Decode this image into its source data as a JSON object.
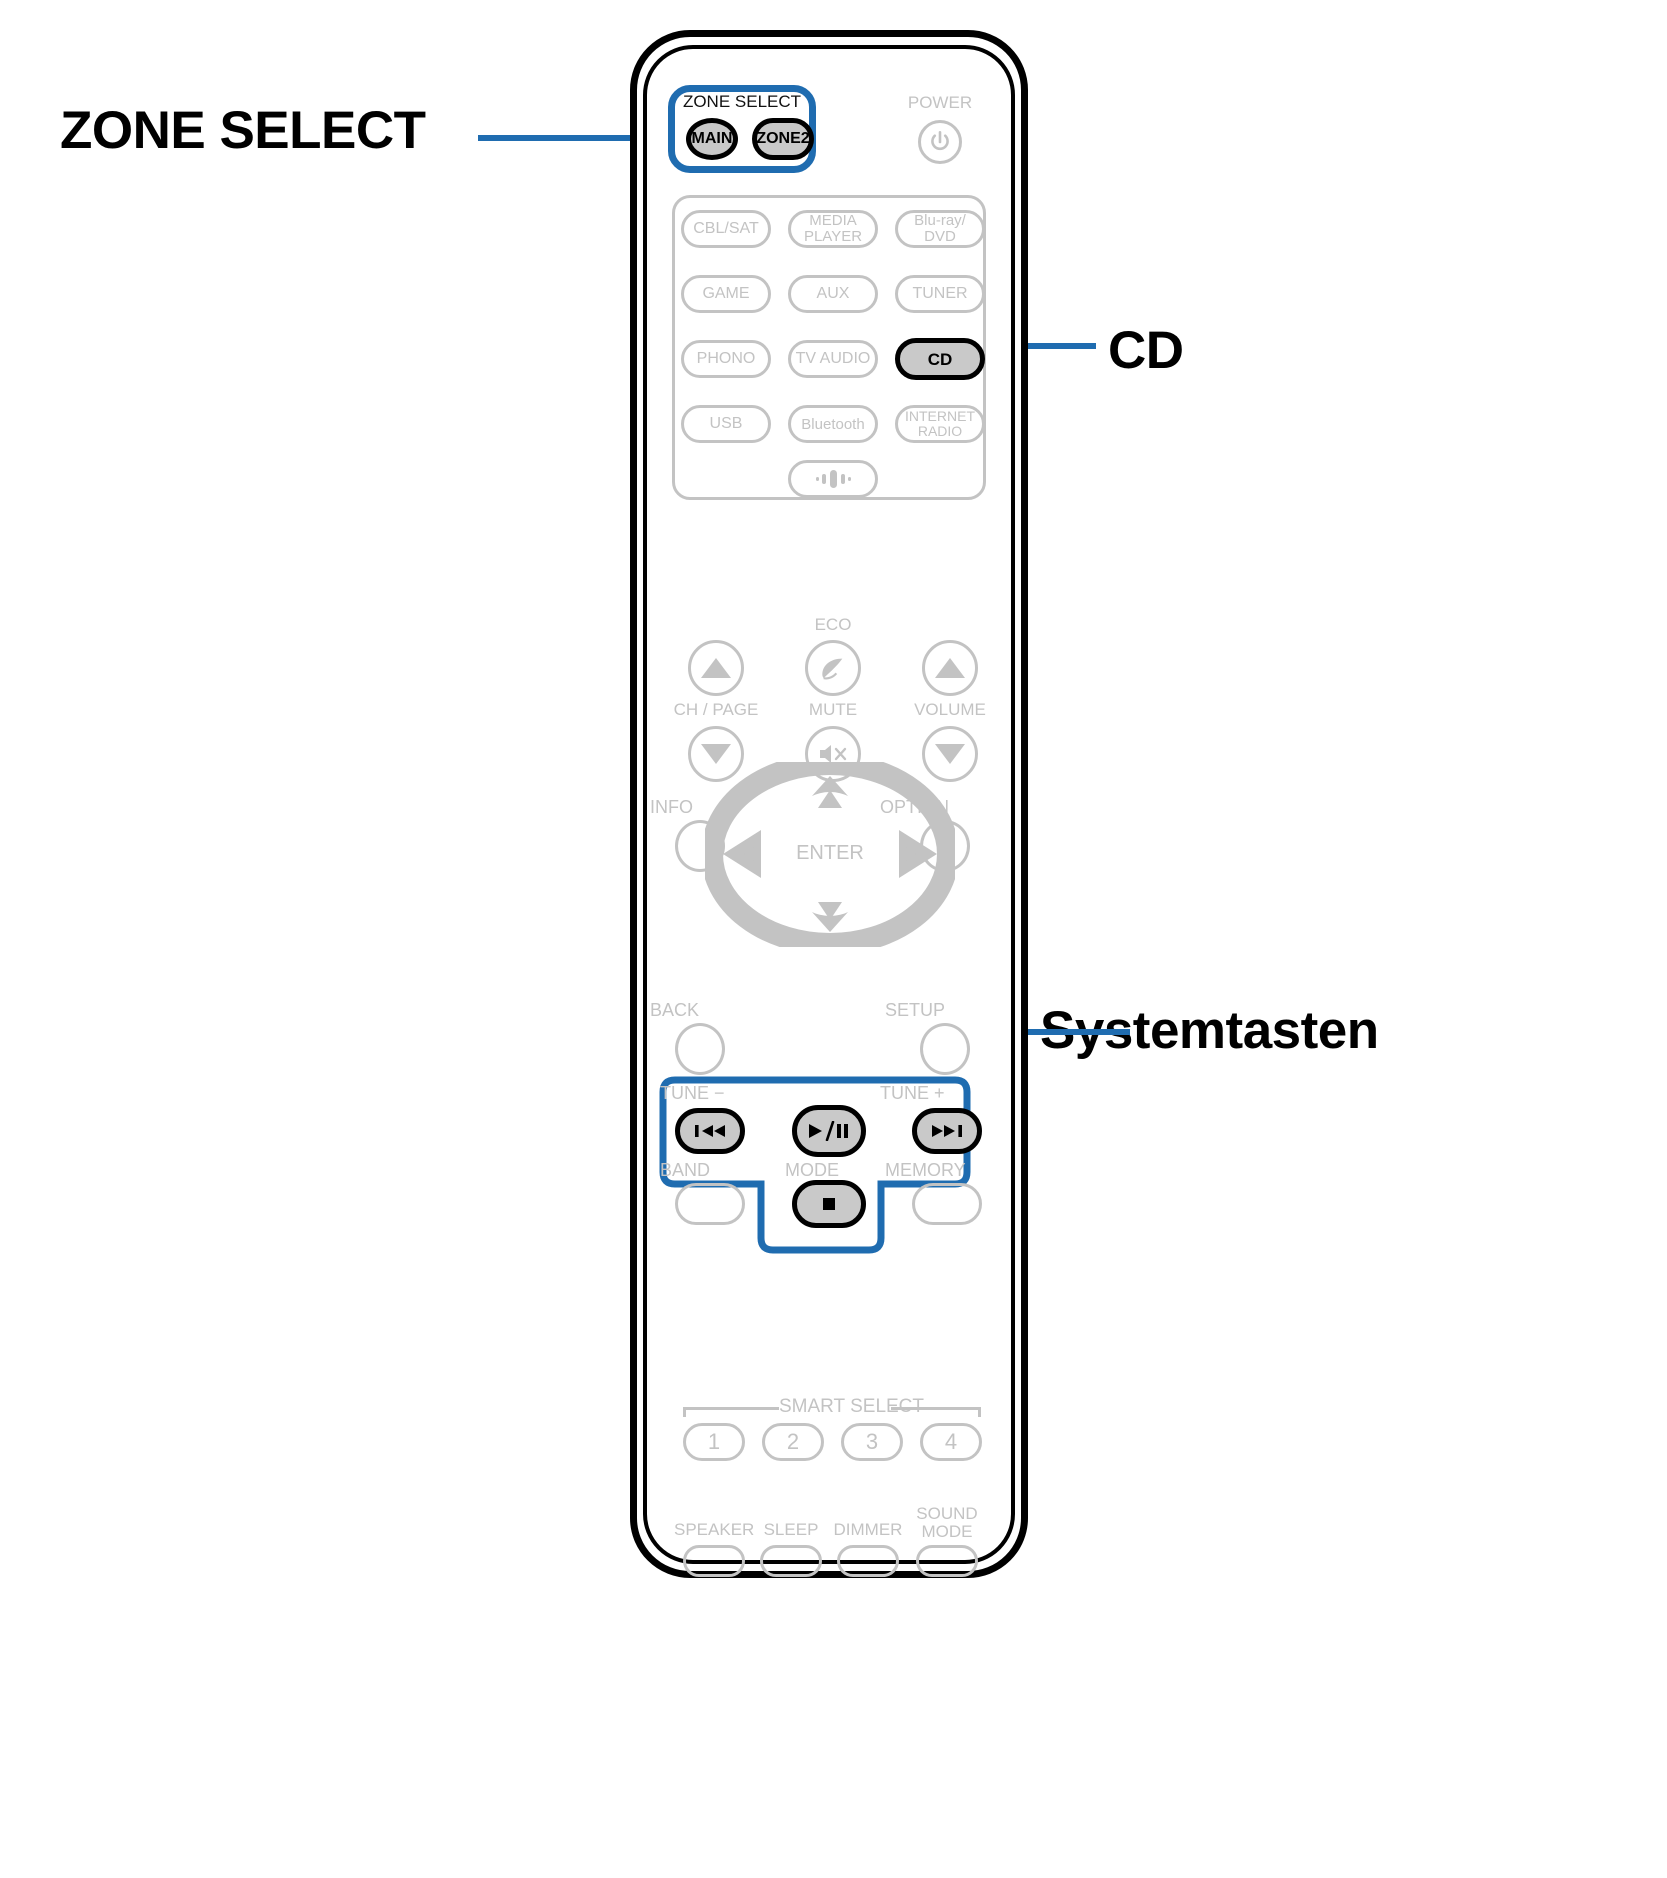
{
  "document": {
    "type": "remote-control-diagram",
    "device": "AV receiver remote control",
    "accent_color": "#1f6cb0",
    "faded_color": "#c3c3c3",
    "highlight_fill": "#c9c9c9"
  },
  "callouts": [
    {
      "id": "zone-select",
      "label": "ZONE SELECT",
      "targets": [
        "MAIN",
        "ZONE2"
      ]
    },
    {
      "id": "cd",
      "label": "CD",
      "targets": [
        "CD"
      ]
    },
    {
      "id": "systemtasten",
      "label": "Systemtasten",
      "targets": [
        "TUNE -",
        "play-pause",
        "TUNE +",
        "stop"
      ]
    }
  ],
  "remote": {
    "zone_select": {
      "group_label": "ZONE SELECT",
      "buttons": [
        {
          "name": "main",
          "label": "MAIN",
          "highlighted": true
        },
        {
          "name": "zone2",
          "label": "ZONE2",
          "highlighted": true
        }
      ]
    },
    "power": {
      "label": "POWER",
      "icon": "power-icon"
    },
    "sources": {
      "rows": [
        [
          {
            "name": "cbl-sat",
            "label": "CBL/SAT",
            "highlighted": false
          },
          {
            "name": "media-player",
            "label": "MEDIA\nPLAYER",
            "highlighted": false
          },
          {
            "name": "blu-ray-dvd",
            "label": "Blu-ray/\nDVD",
            "highlighted": false
          }
        ],
        [
          {
            "name": "game",
            "label": "GAME",
            "highlighted": false
          },
          {
            "name": "aux",
            "label": "AUX",
            "highlighted": false
          },
          {
            "name": "tuner",
            "label": "TUNER",
            "highlighted": false
          }
        ],
        [
          {
            "name": "phono",
            "label": "PHONO",
            "highlighted": false
          },
          {
            "name": "tv-audio",
            "label": "TV AUDIO",
            "highlighted": false
          },
          {
            "name": "cd",
            "label": "CD",
            "highlighted": true
          }
        ],
        [
          {
            "name": "usb",
            "label": "USB",
            "highlighted": false
          },
          {
            "name": "bluetooth",
            "label": "Bluetooth",
            "highlighted": false
          },
          {
            "name": "internet-radio",
            "label": "INTERNET\nRADIO",
            "highlighted": false
          }
        ]
      ],
      "heos": {
        "name": "heos",
        "label": "",
        "icon": "heos-sound-icon"
      }
    },
    "controls": {
      "ch_page_label": "CH / PAGE",
      "eco_label": "ECO",
      "mute_label": "MUTE",
      "volume_label": "VOLUME",
      "ch_page_up_icon": "triangle-up-icon",
      "ch_page_down_icon": "triangle-down-icon",
      "volume_up_icon": "triangle-up-icon",
      "volume_down_icon": "triangle-down-icon",
      "eco_icon": "leaf-icon",
      "mute_icon": "speaker-mute-icon"
    },
    "navigation": {
      "info_label": "INFO",
      "option_label": "OPTION",
      "back_label": "BACK",
      "setup_label": "SETUP",
      "enter_label": "ENTER",
      "up_icon": "triangle-up-icon",
      "down_icon": "triangle-down-icon",
      "left_icon": "triangle-left-icon",
      "right_icon": "triangle-right-icon"
    },
    "system_buttons": {
      "tune_minus_label": "TUNE −",
      "tune_plus_label": "TUNE +",
      "band_label": "BAND",
      "mode_label": "MODE",
      "memory_label": "MEMORY",
      "skip_prev_icon": "skip-previous-icon",
      "play_pause_icon": "play-pause-icon",
      "skip_next_icon": "skip-next-icon",
      "stop_icon": "stop-icon",
      "highlighted": [
        "skip-previous",
        "play-pause",
        "skip-next",
        "stop"
      ]
    },
    "smart_select": {
      "group_label": "SMART SELECT",
      "buttons": [
        {
          "name": "smart-1",
          "label": "1"
        },
        {
          "name": "smart-2",
          "label": "2"
        },
        {
          "name": "smart-3",
          "label": "3"
        },
        {
          "name": "smart-4",
          "label": "4"
        }
      ]
    },
    "bottom_row": [
      {
        "name": "speaker",
        "label": "SPEAKER"
      },
      {
        "name": "sleep",
        "label": "SLEEP"
      },
      {
        "name": "dimmer",
        "label": "DIMMER"
      },
      {
        "name": "sound-mode",
        "label": "SOUND\nMODE"
      }
    ]
  }
}
